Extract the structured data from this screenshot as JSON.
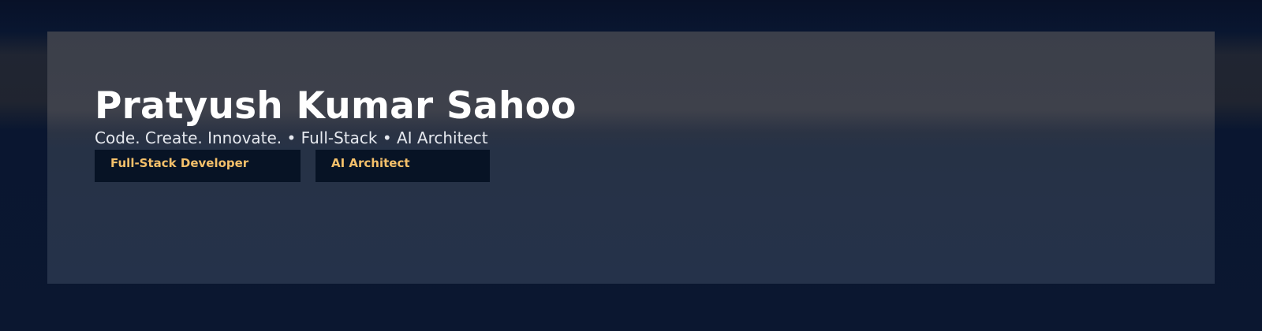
{
  "hero": {
    "name": "Pratyush Kumar Sahoo",
    "tagline": "Code. Create. Innovate. • Full-Stack • AI Architect",
    "badges": [
      {
        "label": "Full-Stack Developer"
      },
      {
        "label": "AI Architect"
      }
    ]
  },
  "colors": {
    "page_background": "#0b1730",
    "card_background": "#25324a",
    "badge_background": "#071325",
    "badge_text": "#f4c06a",
    "title_text": "#ffffff"
  }
}
